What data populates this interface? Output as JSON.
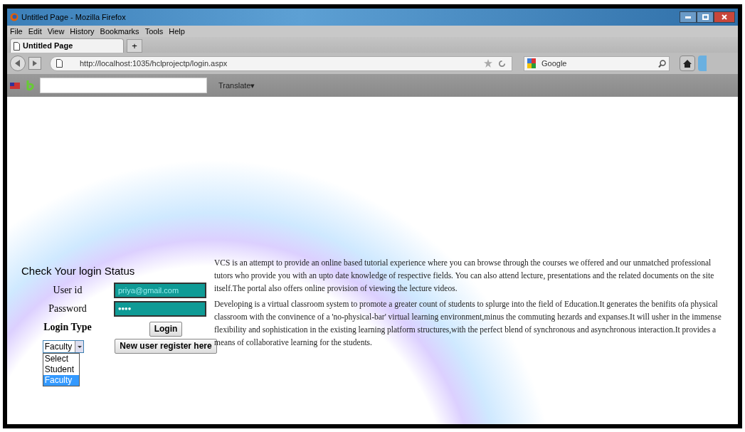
{
  "window": {
    "title": "Untitled Page - Mozilla Firefox"
  },
  "menu": [
    "File",
    "Edit",
    "View",
    "History",
    "Bookmarks",
    "Tools",
    "Help"
  ],
  "tabs": [
    {
      "label": "Untitled Page",
      "selected": true
    }
  ],
  "new_tab": "+",
  "address_bar": {
    "url": "http://localhost:1035/hclprojectp/login.aspx"
  },
  "search_bar": {
    "engine": "Google"
  },
  "toolbar": {
    "translate": "Translate▾"
  },
  "login": {
    "heading": "Check Your login Status",
    "user_id": {
      "label": "User id",
      "value": "priya@gmail.com"
    },
    "password": {
      "label": "Password",
      "value": "••••"
    },
    "login_type": {
      "label": "Login Type",
      "value": "Faculty",
      "expanded": true,
      "options": [
        {
          "label": "Select",
          "selected": false
        },
        {
          "label": "Student",
          "selected": false
        },
        {
          "label": "Faculty",
          "selected": true
        }
      ]
    },
    "buttons": [
      "Login",
      "New user register here"
    ]
  },
  "paragraphs": [
    "VCS is an attempt to provide an online based tutorial experience where you can browse through the courses we offered and our unmatched professional tutors who provide you with an upto date knowledge of respective fields. You can also attend lecture, presentations and the related documents on the site itself.The portal also offers online provision of viewing the lecture videos.",
    "Developing is a virtual classroom system to promote a greater count of students to splurge into the field of Education.It generates the benifits ofa physical classroom with the convinence of a 'no-physical-bar' virtual learning environment,minus the commuting hezards and expanses.It will usher in the immense flexibility and sophistication in the existing learning platform structures,with the perfect blend of synchronous and asynchronous interaction.It provides a means of collaborative learning for the students."
  ]
}
